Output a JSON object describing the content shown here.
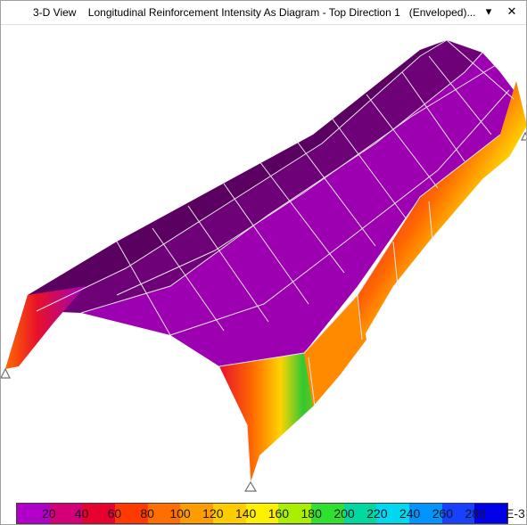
{
  "window": {
    "title": "3-D View    Longitudinal Reinforcement Intensity As Diagram - Top Direction 1   (Enveloped)...",
    "dropdown_icon": "chevron-down-icon",
    "close_icon": "close-icon",
    "dropdown_glyph": "▾",
    "close_glyph": "✕"
  },
  "model": {
    "description_icon": "pin-support-icon",
    "colors": {
      "low": "#a000c0",
      "crown_dark": "#5a0060",
      "crown_mid": "#7a0085",
      "purple": "#9c00b0",
      "red": "#e8102a",
      "orange": "#ff6a00",
      "yellow": "#ffd400",
      "green": "#32c832",
      "cyan": "#00d2e6",
      "blue": "#1a50ff"
    }
  },
  "legend": {
    "labels": [
      "20",
      "40",
      "60",
      "80",
      "100",
      "120",
      "140",
      "160",
      "180",
      "200",
      "220",
      "240",
      "260",
      "280"
    ],
    "unit": "E-3",
    "colors": [
      "#b000c8",
      "#d4007a",
      "#e8002e",
      "#ff3a00",
      "#ff6e00",
      "#ff9c00",
      "#ffcc00",
      "#fff000",
      "#a8f000",
      "#30e030",
      "#00d8a0",
      "#00d8f0",
      "#0094ff",
      "#1840ff",
      "#0000e8"
    ]
  }
}
